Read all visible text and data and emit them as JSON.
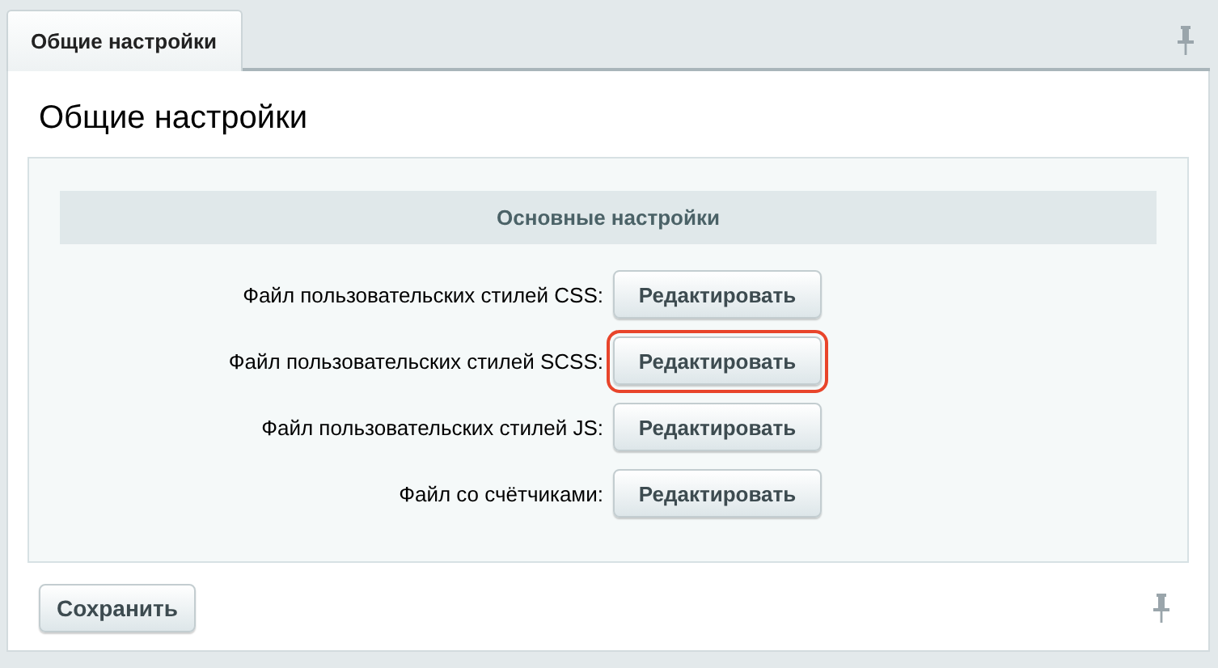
{
  "tabs": [
    {
      "label": "Общие настройки",
      "selected": true
    }
  ],
  "title": "Общие настройки",
  "section": {
    "heading": "Основные настройки",
    "rows": [
      {
        "label": "Файл пользовательских стилей CSS:",
        "button": "Редактировать",
        "highlighted": false
      },
      {
        "label": "Файл пользовательских стилей SCSS:",
        "button": "Редактировать",
        "highlighted": true
      },
      {
        "label": "Файл пользовательских стилей JS:",
        "button": "Редактировать",
        "highlighted": false
      },
      {
        "label": "Файл со счётчиками:",
        "button": "Редактировать",
        "highlighted": false
      }
    ]
  },
  "save_button": "Сохранить"
}
